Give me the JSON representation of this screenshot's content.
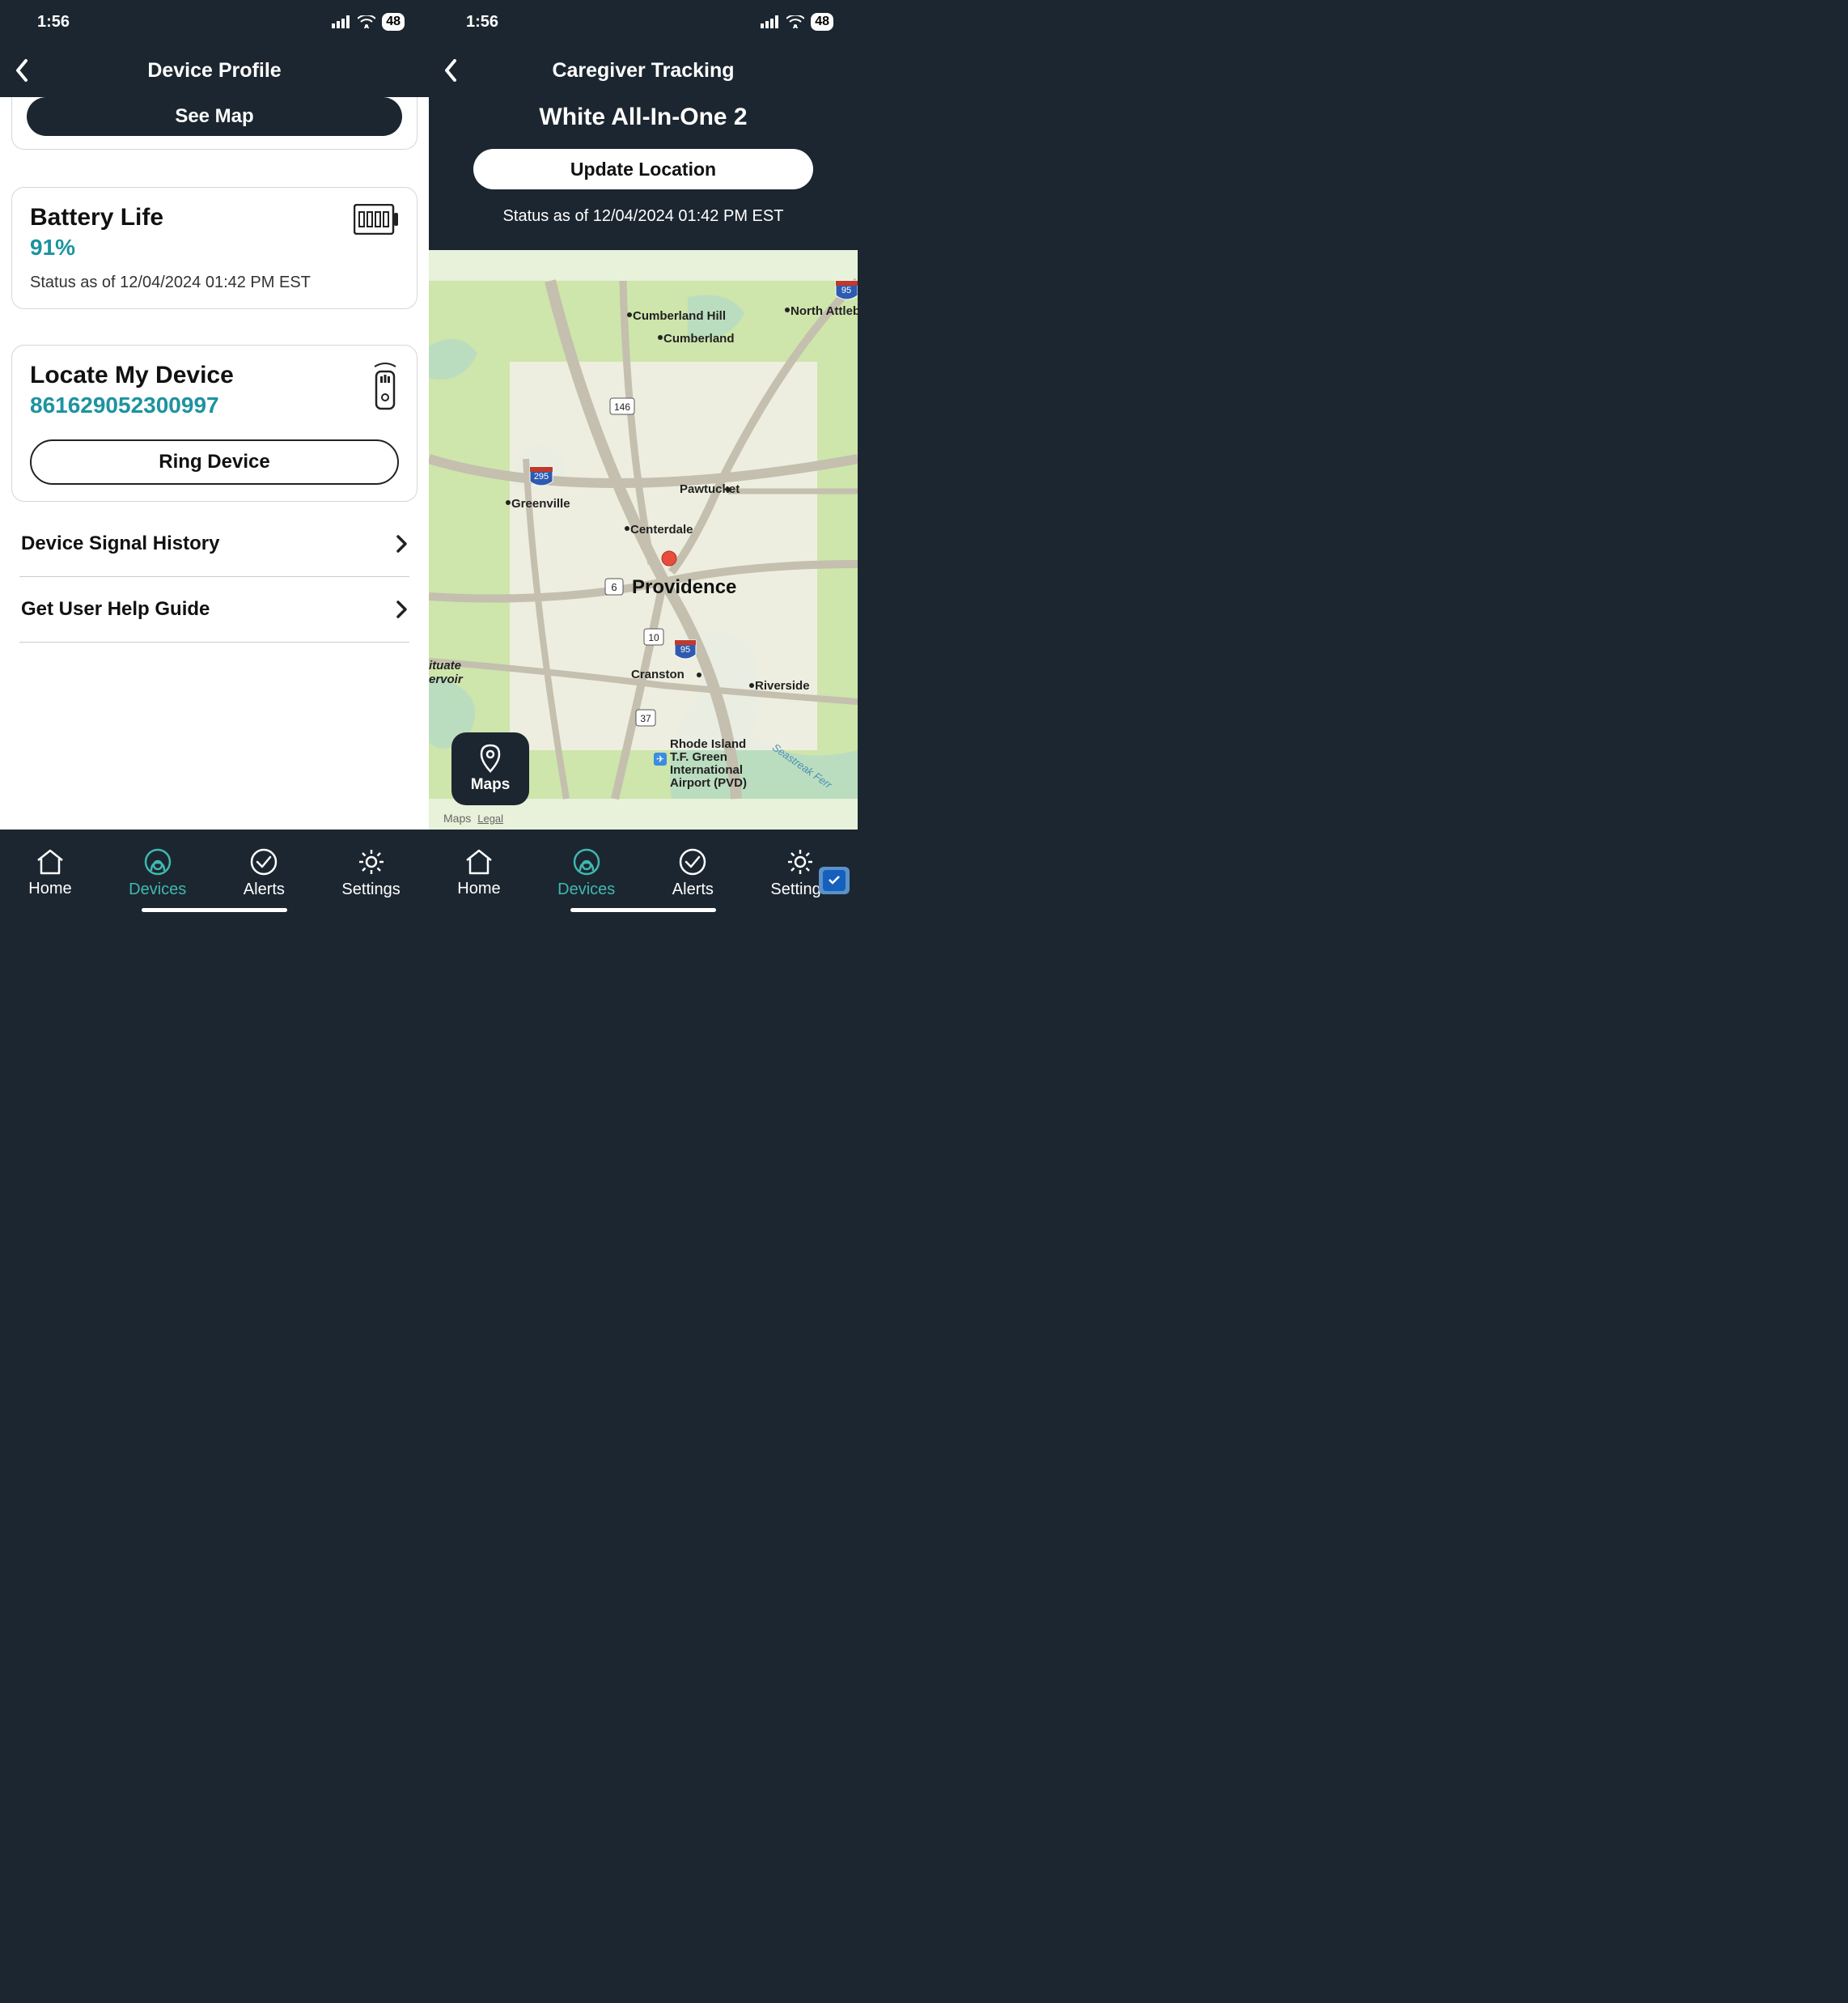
{
  "status_bar": {
    "time": "1:56",
    "battery_pct": "48"
  },
  "left": {
    "title": "Device Profile",
    "see_map": "See Map",
    "battery": {
      "title": "Battery Life",
      "value": "91%",
      "status": "Status as of 12/04/2024 01:42 PM EST"
    },
    "locate": {
      "title": "Locate My Device",
      "value": "861629052300997",
      "ring_label": "Ring Device"
    },
    "links": {
      "signal_history": "Device Signal History",
      "help_guide": "Get User Help Guide"
    }
  },
  "right": {
    "title": "Caregiver Tracking",
    "device_name": "White All-In-One 2",
    "update_location": "Update Location",
    "status": "Status as of 12/04/2024 01:42 PM EST",
    "maps_button": "Maps",
    "apple_maps": "Maps",
    "legal": "Legal",
    "map_places": {
      "north_attleb": "North Attleb",
      "cumberland_hill": "Cumberland Hill",
      "cumberland": "Cumberland",
      "pawtucket": "Pawtucket",
      "greenville": "Greenville",
      "centerdale": "Centerdale",
      "providence": "Providence",
      "cranston": "Cranston",
      "riverside": "Riverside",
      "ituate": "ituate",
      "ervoir": "ervoir",
      "airport1": "Rhode Island",
      "airport2": "T.F. Green",
      "airport3": "International",
      "airport4": "Airport (PVD)",
      "seastreak": "Seastreak Ferr"
    },
    "route_labels": {
      "r146": "146",
      "r295": "295",
      "r6": "6",
      "r10": "10",
      "r95": "95",
      "r95b": "95",
      "r37": "37"
    }
  },
  "tabs": {
    "home": "Home",
    "devices": "Devices",
    "alerts": "Alerts",
    "settings": "Settings"
  }
}
